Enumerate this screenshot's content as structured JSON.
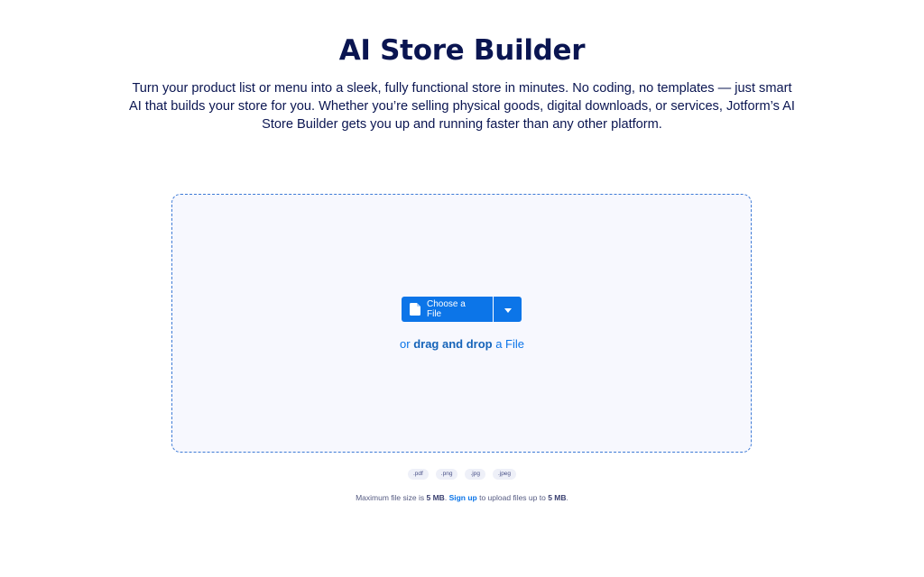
{
  "header": {
    "title": "AI Store Builder",
    "description": "Turn your product list or menu into a sleek, fully functional store in minutes. No coding, no templates — just smart AI that builds your store for you. Whether you’re selling physical goods, digital downloads, or services, Jotform’s AI Store Builder gets you up and running faster than any other platform."
  },
  "upload": {
    "choose_label": "Choose a File",
    "choose_icon": "file-icon",
    "dropdown_icon": "caret-down-icon",
    "drop_prefix": "or",
    "drop_emphasis": "drag and drop",
    "drop_suffix": "a File",
    "formats": [
      ".pdf",
      ".png",
      ".jpg",
      ".jpeg"
    ],
    "limit_prefix": "Maximum file size is",
    "limit_size": "5 MB",
    "limit_punct": ".",
    "signup_label": "Sign up",
    "limit_middle": "to upload files up to",
    "signup_size": "5 MB",
    "limit_end": "."
  },
  "colors": {
    "title": "#0a1551",
    "accent": "#0c75e8",
    "dropzone_border": "#3e7bd6",
    "dropzone_bg": "#f7f8fe"
  }
}
